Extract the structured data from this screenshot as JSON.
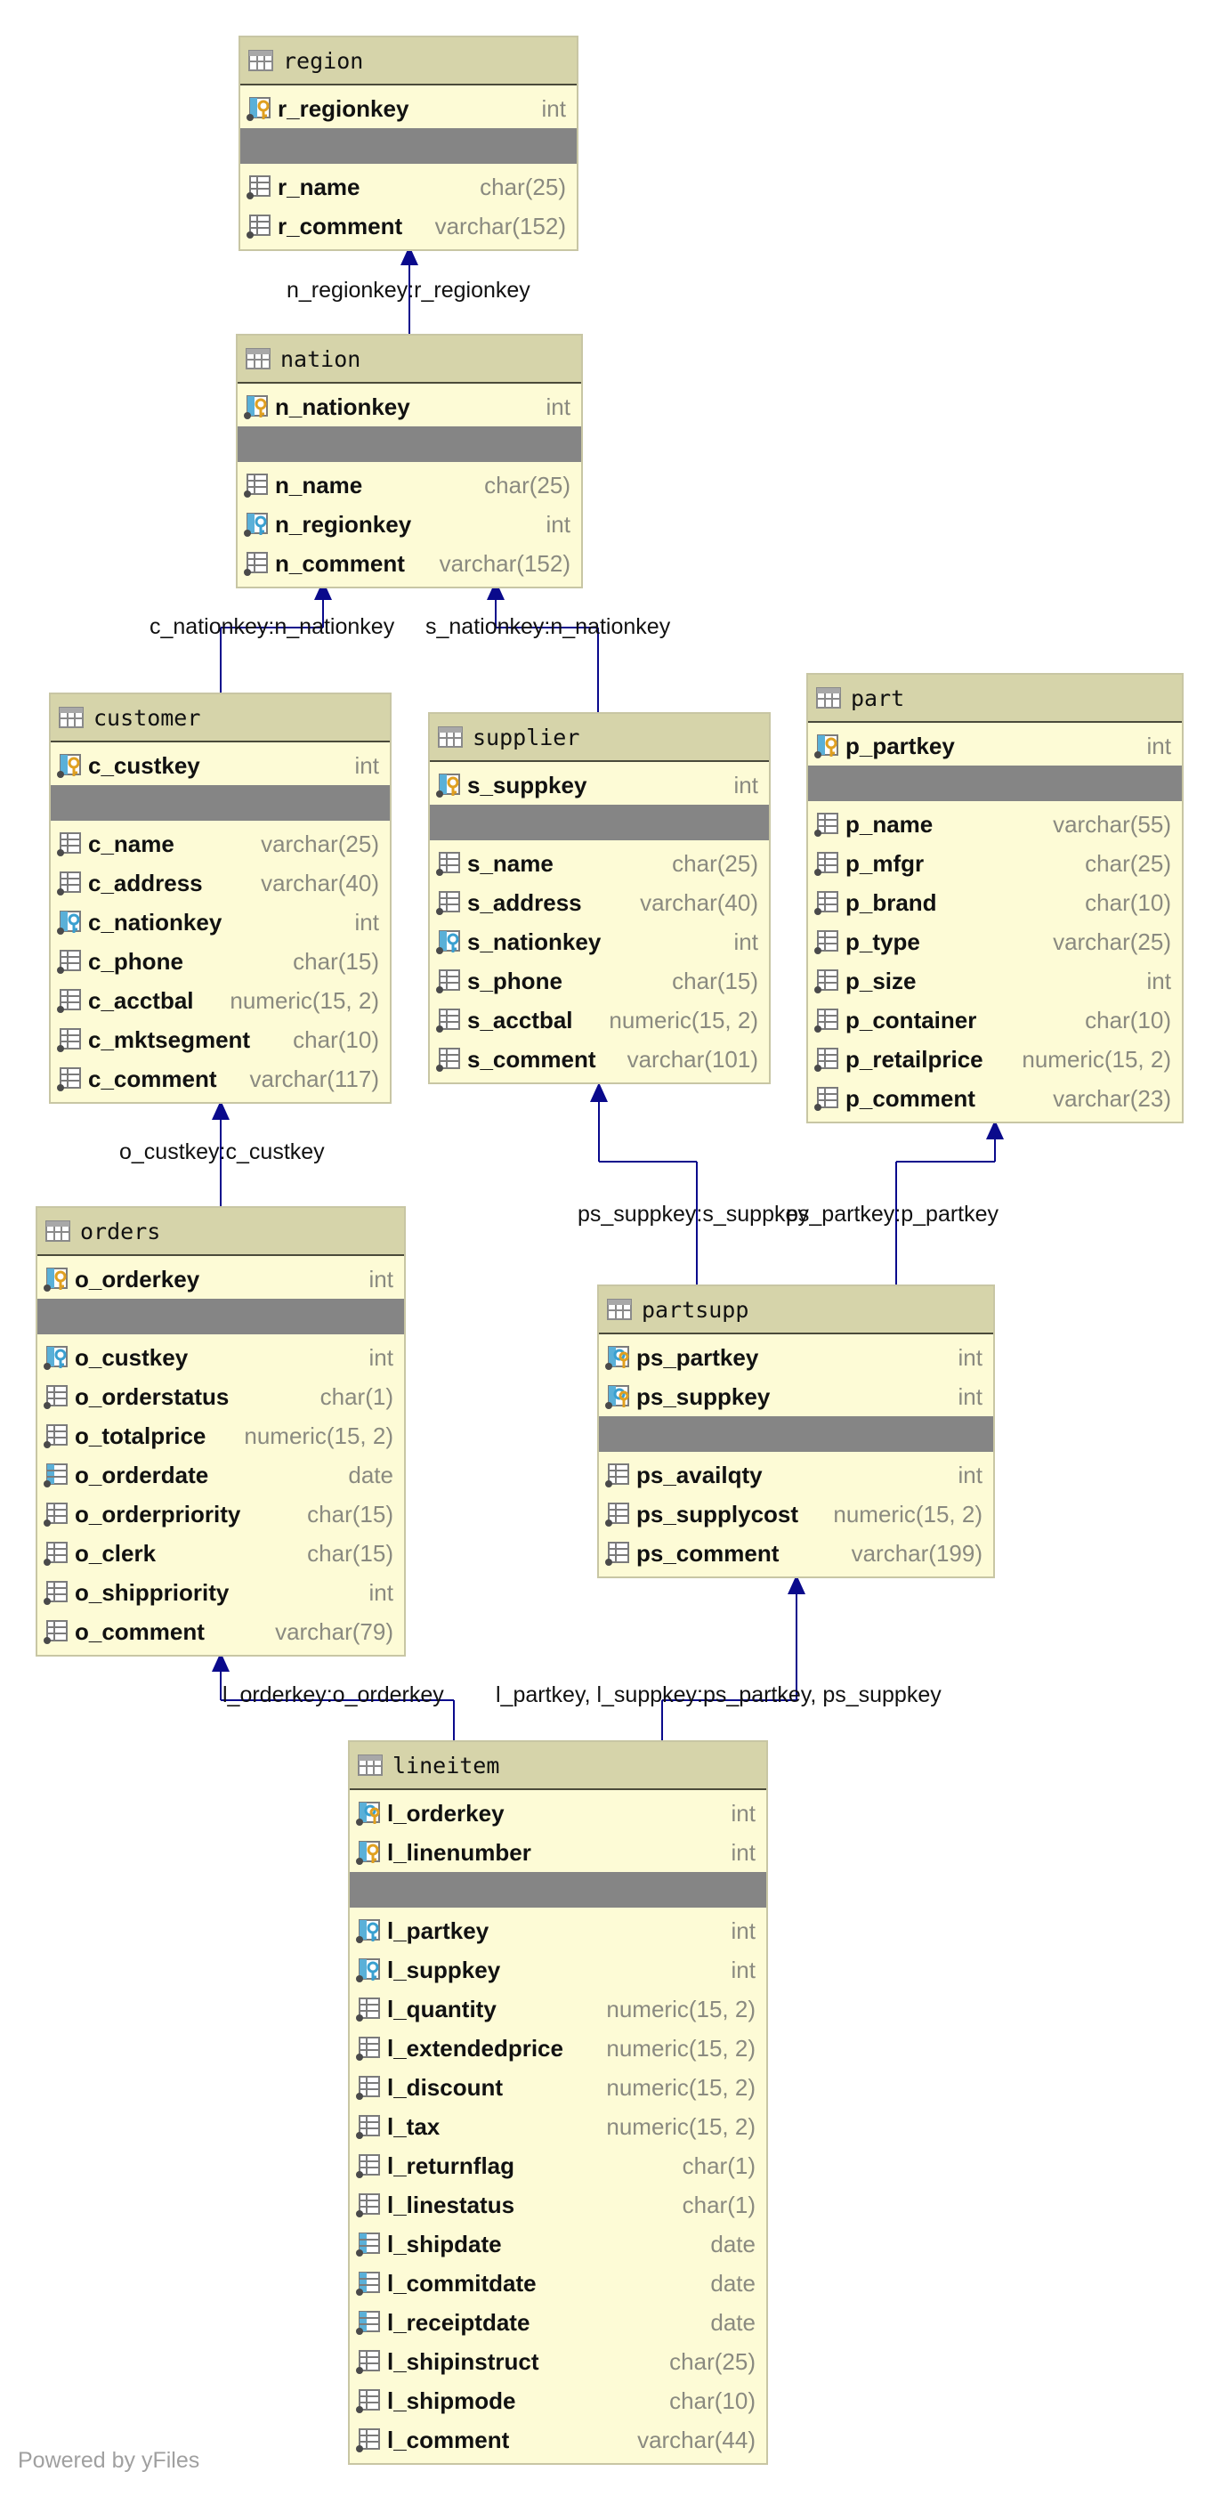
{
  "diagram": {
    "tables": [
      {
        "id": "region",
        "name": "region",
        "pk": [
          {
            "name": "r_regionkey",
            "type": "int",
            "icon": "primary-key-icon"
          }
        ],
        "columns": [
          {
            "name": "r_name",
            "type": "char(25)",
            "icon": "column-icon"
          },
          {
            "name": "r_comment",
            "type": "varchar(152)",
            "icon": "column-icon"
          }
        ]
      },
      {
        "id": "nation",
        "name": "nation",
        "pk": [
          {
            "name": "n_nationkey",
            "type": "int",
            "icon": "primary-key-icon"
          }
        ],
        "columns": [
          {
            "name": "n_name",
            "type": "char(25)",
            "icon": "column-icon"
          },
          {
            "name": "n_regionkey",
            "type": "int",
            "icon": "foreign-key-icon"
          },
          {
            "name": "n_comment",
            "type": "varchar(152)",
            "icon": "column-icon"
          }
        ]
      },
      {
        "id": "customer",
        "name": "customer",
        "pk": [
          {
            "name": "c_custkey",
            "type": "int",
            "icon": "primary-key-icon"
          }
        ],
        "columns": [
          {
            "name": "c_name",
            "type": "varchar(25)",
            "icon": "column-icon"
          },
          {
            "name": "c_address",
            "type": "varchar(40)",
            "icon": "column-icon"
          },
          {
            "name": "c_nationkey",
            "type": "int",
            "icon": "foreign-key-icon"
          },
          {
            "name": "c_phone",
            "type": "char(15)",
            "icon": "column-icon"
          },
          {
            "name": "c_acctbal",
            "type": "numeric(15, 2)",
            "icon": "column-icon"
          },
          {
            "name": "c_mktsegment",
            "type": "char(10)",
            "icon": "column-icon"
          },
          {
            "name": "c_comment",
            "type": "varchar(117)",
            "icon": "column-icon"
          }
        ]
      },
      {
        "id": "supplier",
        "name": "supplier",
        "pk": [
          {
            "name": "s_suppkey",
            "type": "int",
            "icon": "primary-key-icon"
          }
        ],
        "columns": [
          {
            "name": "s_name",
            "type": "char(25)",
            "icon": "column-icon"
          },
          {
            "name": "s_address",
            "type": "varchar(40)",
            "icon": "column-icon"
          },
          {
            "name": "s_nationkey",
            "type": "int",
            "icon": "foreign-key-icon"
          },
          {
            "name": "s_phone",
            "type": "char(15)",
            "icon": "column-icon"
          },
          {
            "name": "s_acctbal",
            "type": "numeric(15, 2)",
            "icon": "column-icon"
          },
          {
            "name": "s_comment",
            "type": "varchar(101)",
            "icon": "column-icon"
          }
        ]
      },
      {
        "id": "part",
        "name": "part",
        "pk": [
          {
            "name": "p_partkey",
            "type": "int",
            "icon": "primary-key-icon"
          }
        ],
        "columns": [
          {
            "name": "p_name",
            "type": "varchar(55)",
            "icon": "column-icon"
          },
          {
            "name": "p_mfgr",
            "type": "char(25)",
            "icon": "column-icon"
          },
          {
            "name": "p_brand",
            "type": "char(10)",
            "icon": "column-icon"
          },
          {
            "name": "p_type",
            "type": "varchar(25)",
            "icon": "column-icon"
          },
          {
            "name": "p_size",
            "type": "int",
            "icon": "column-icon"
          },
          {
            "name": "p_container",
            "type": "char(10)",
            "icon": "column-icon"
          },
          {
            "name": "p_retailprice",
            "type": "numeric(15, 2)",
            "icon": "column-icon"
          },
          {
            "name": "p_comment",
            "type": "varchar(23)",
            "icon": "column-icon"
          }
        ]
      },
      {
        "id": "orders",
        "name": "orders",
        "pk": [
          {
            "name": "o_orderkey",
            "type": "int",
            "icon": "primary-key-icon"
          }
        ],
        "columns": [
          {
            "name": "o_custkey",
            "type": "int",
            "icon": "foreign-key-icon"
          },
          {
            "name": "o_orderstatus",
            "type": "char(1)",
            "icon": "column-icon"
          },
          {
            "name": "o_totalprice",
            "type": "numeric(15, 2)",
            "icon": "column-icon"
          },
          {
            "name": "o_orderdate",
            "type": "date",
            "icon": "indexed-column-icon"
          },
          {
            "name": "o_orderpriority",
            "type": "char(15)",
            "icon": "column-icon"
          },
          {
            "name": "o_clerk",
            "type": "char(15)",
            "icon": "column-icon"
          },
          {
            "name": "o_shippriority",
            "type": "int",
            "icon": "column-icon"
          },
          {
            "name": "o_comment",
            "type": "varchar(79)",
            "icon": "column-icon"
          }
        ]
      },
      {
        "id": "partsupp",
        "name": "partsupp",
        "pk": [
          {
            "name": "ps_partkey",
            "type": "int",
            "icon": "primary-foreign-key-icon"
          },
          {
            "name": "ps_suppkey",
            "type": "int",
            "icon": "primary-foreign-key-icon"
          }
        ],
        "columns": [
          {
            "name": "ps_availqty",
            "type": "int",
            "icon": "column-icon"
          },
          {
            "name": "ps_supplycost",
            "type": "numeric(15, 2)",
            "icon": "column-icon"
          },
          {
            "name": "ps_comment",
            "type": "varchar(199)",
            "icon": "column-icon"
          }
        ]
      },
      {
        "id": "lineitem",
        "name": "lineitem",
        "pk": [
          {
            "name": "l_orderkey",
            "type": "int",
            "icon": "primary-foreign-key-icon"
          },
          {
            "name": "l_linenumber",
            "type": "int",
            "icon": "primary-key-icon"
          }
        ],
        "columns": [
          {
            "name": "l_partkey",
            "type": "int",
            "icon": "foreign-key-icon"
          },
          {
            "name": "l_suppkey",
            "type": "int",
            "icon": "foreign-key-icon"
          },
          {
            "name": "l_quantity",
            "type": "numeric(15, 2)",
            "icon": "column-icon"
          },
          {
            "name": "l_extendedprice",
            "type": "numeric(15, 2)",
            "icon": "column-icon"
          },
          {
            "name": "l_discount",
            "type": "numeric(15, 2)",
            "icon": "column-icon"
          },
          {
            "name": "l_tax",
            "type": "numeric(15, 2)",
            "icon": "column-icon"
          },
          {
            "name": "l_returnflag",
            "type": "char(1)",
            "icon": "column-icon"
          },
          {
            "name": "l_linestatus",
            "type": "char(1)",
            "icon": "column-icon"
          },
          {
            "name": "l_shipdate",
            "type": "date",
            "icon": "indexed-column-icon"
          },
          {
            "name": "l_commitdate",
            "type": "date",
            "icon": "indexed-column-icon"
          },
          {
            "name": "l_receiptdate",
            "type": "date",
            "icon": "indexed-column-icon"
          },
          {
            "name": "l_shipinstruct",
            "type": "char(25)",
            "icon": "column-icon"
          },
          {
            "name": "l_shipmode",
            "type": "char(10)",
            "icon": "column-icon"
          },
          {
            "name": "l_comment",
            "type": "varchar(44)",
            "icon": "column-icon"
          }
        ]
      }
    ],
    "relations": [
      {
        "from": "nation",
        "to": "region",
        "label": "n_regionkey:r_regionkey"
      },
      {
        "from": "customer",
        "to": "nation",
        "label": "c_nationkey:n_nationkey"
      },
      {
        "from": "supplier",
        "to": "nation",
        "label": "s_nationkey:n_nationkey"
      },
      {
        "from": "orders",
        "to": "customer",
        "label": "o_custkey:c_custkey"
      },
      {
        "from": "partsupp",
        "to": "supplier",
        "label": "ps_suppkey:s_suppkey"
      },
      {
        "from": "partsupp",
        "to": "part",
        "label": "ps_partkey:p_partkey"
      },
      {
        "from": "lineitem",
        "to": "orders",
        "label": "l_orderkey:o_orderkey"
      },
      {
        "from": "lineitem",
        "to": "partsupp",
        "label": "l_partkey, l_suppkey:ps_partkey, ps_suppkey"
      }
    ],
    "colors": {
      "table_bg": "#fdfbd6",
      "header_bg": "#d6d4aa",
      "separator": "#858585",
      "connector": "#0a0a8c",
      "type_text": "#8a8a80"
    }
  },
  "footer": {
    "text": "Powered by yFiles"
  }
}
